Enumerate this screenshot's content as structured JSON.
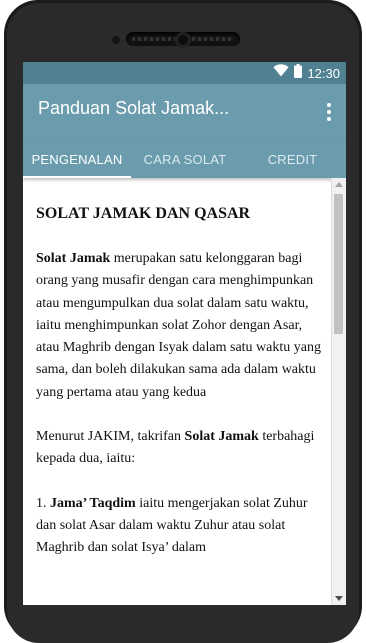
{
  "status_bar": {
    "time": "12:30",
    "icons": [
      "wifi-icon",
      "battery-icon"
    ]
  },
  "app_bar": {
    "title": "Panduan Solat Jamak..."
  },
  "tabs": [
    {
      "label": "PENGENALAN",
      "active": true
    },
    {
      "label": "CARA SOLAT",
      "active": false
    },
    {
      "label": "CREDIT",
      "active": false
    }
  ],
  "content": {
    "heading": "SOLAT JAMAK DAN QASAR",
    "p1_bold": "Solat Jamak",
    "p1_text": " merupakan satu kelonggaran bagi orang yang musafir dengan cara menghimpunkan atau mengumpulkan dua solat dalam satu waktu, iaitu menghimpunkan solat Zohor dengan Asar, atau Maghrib dengan Isyak dalam satu waktu yang sama, dan boleh dilakukan sama ada dalam waktu yang pertama atau yang kedua",
    "p2_text_a": "Menurut JAKIM, takrifan ",
    "p2_bold": "Solat Jamak",
    "p2_text_b": " terbahagi kepada dua, iaitu:",
    "item1_num": "1. ",
    "item1_bold": "Jama’ Taqdim",
    "item1_text": " iaitu mengerjakan solat Zuhur dan solat Asar dalam waktu Zuhur atau solat Maghrib dan solat Isya’ dalam"
  },
  "colors": {
    "status_bar": "#4f8193",
    "app_bar": "#6a9cae"
  }
}
